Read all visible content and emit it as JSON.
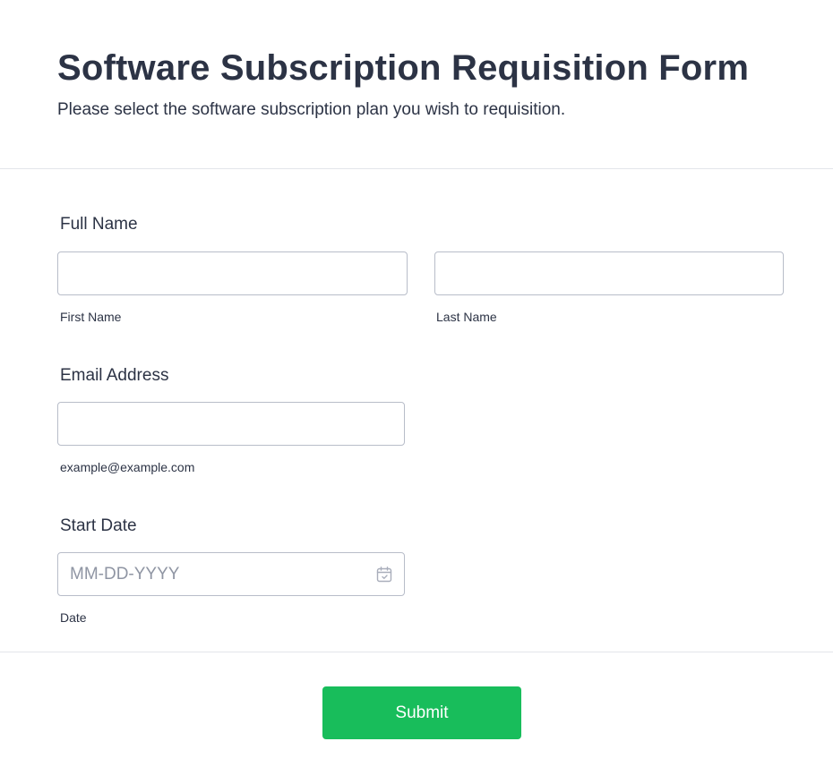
{
  "form": {
    "title": "Software Subscription Requisition Form",
    "subtitle": "Please select the software subscription plan you wish to requisition."
  },
  "full_name": {
    "label": "Full Name",
    "first_name": {
      "value": "",
      "sublabel": "First Name"
    },
    "last_name": {
      "value": "",
      "sublabel": "Last Name"
    }
  },
  "email": {
    "label": "Email Address",
    "value": "",
    "sublabel": "example@example.com"
  },
  "start_date": {
    "label": "Start Date",
    "value": "",
    "placeholder": "MM-DD-YYYY",
    "sublabel": "Date",
    "icon": "calendar-icon"
  },
  "submit": {
    "label": "Submit"
  },
  "colors": {
    "text": "#2c3345",
    "input_border": "#b8bdc9",
    "placeholder": "#8f95a3",
    "divider": "#e3e5ea",
    "submit_bg": "#18bd5b",
    "submit_text": "#ffffff"
  }
}
